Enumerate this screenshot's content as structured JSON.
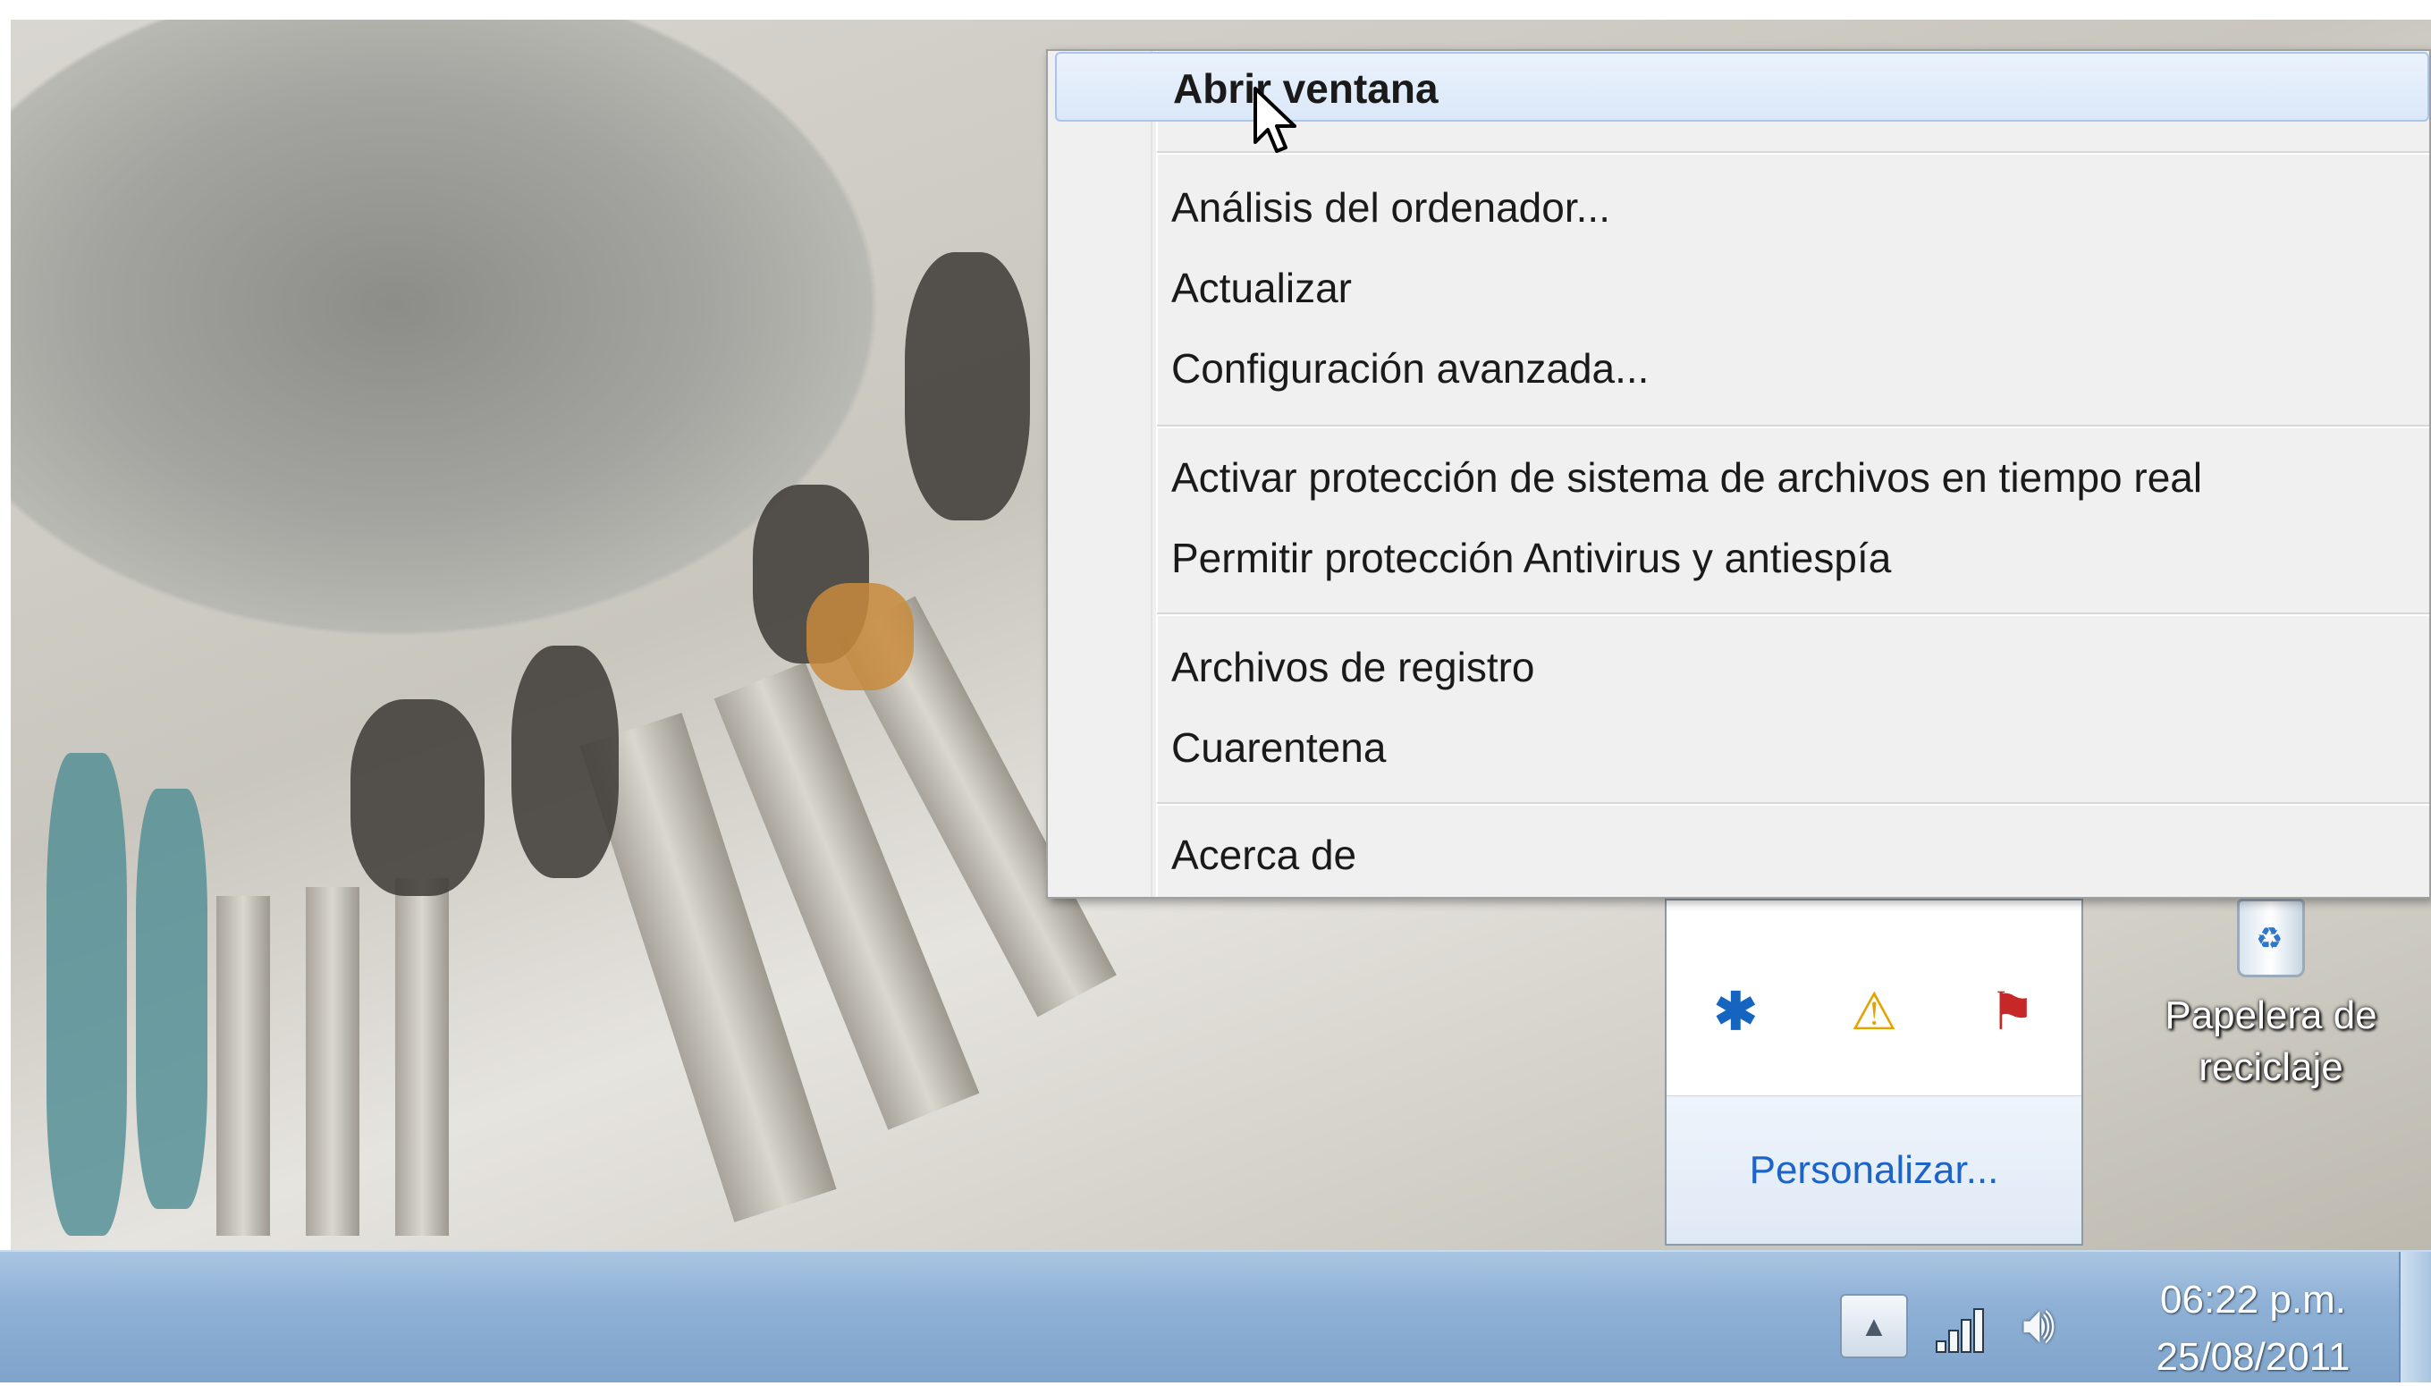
{
  "context_menu": {
    "items": [
      {
        "label": "Abrir ventana",
        "highlighted": true
      },
      {
        "label": "Análisis del ordenador..."
      },
      {
        "label": "Actualizar"
      },
      {
        "label": "Configuración avanzada..."
      },
      {
        "label": "Activar protección de sistema de archivos en tiempo real"
      },
      {
        "label": "Permitir protección Antivirus y antiespía"
      },
      {
        "label": "Archivos de registro"
      },
      {
        "label": "Cuarentena"
      },
      {
        "label": "Acerca de"
      }
    ]
  },
  "tray_overflow": {
    "icons": [
      "bluetooth-icon",
      "folder-warning-icon",
      "flag-error-icon"
    ],
    "customize_label": "Personalizar..."
  },
  "desktop": {
    "recycle_bin_label_line1": "Papelera de",
    "recycle_bin_label_line2": "reciclaje"
  },
  "taskbar": {
    "time": "06:22 p.m.",
    "date": "25/08/2011"
  }
}
